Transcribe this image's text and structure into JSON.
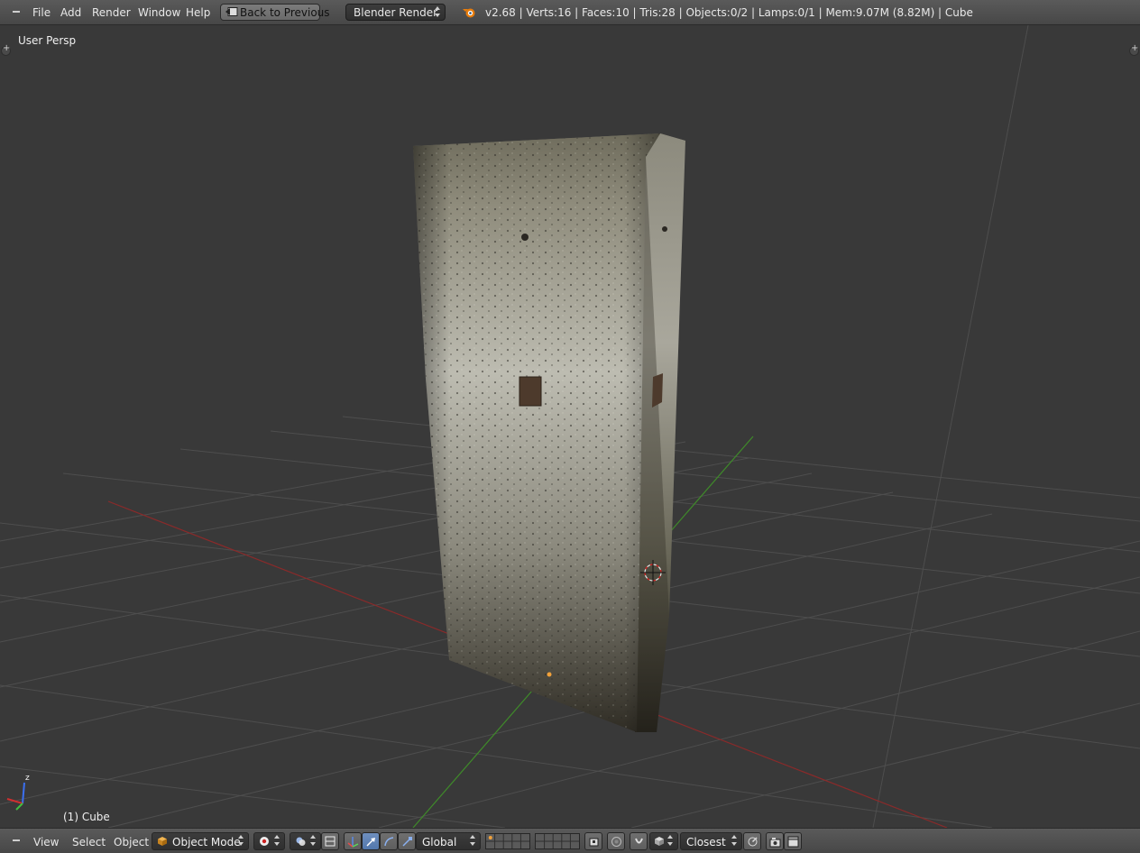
{
  "top_menu": [
    "File",
    "Add",
    "Render",
    "Window",
    "Help"
  ],
  "back_button": "Back to Previous",
  "render_engine": "Blender Render",
  "stats": "v2.68 | Verts:16 | Faces:10 | Tris:28 | Objects:0/2 | Lamps:0/1 | Mem:9.07M (8.82M) | Cube",
  "viewport": {
    "view_label": "User Persp",
    "object_label": "(1) Cube",
    "axis_z": "z"
  },
  "bottom_menu": [
    "View",
    "Select",
    "Object"
  ],
  "mode": "Object Mode",
  "transform_orientation": "Global",
  "snap_target": "Closest",
  "colors": {
    "background": "#393939",
    "header": "#4e4e4e",
    "grid": "#4c4c4c",
    "x_axis": "#8a2a2a",
    "y_axis": "#3f8a2a",
    "active_button": "#5277ad"
  },
  "icons": [
    "collapse-icon",
    "back-icon",
    "blender-logo-icon",
    "cube-icon",
    "pivot-icon",
    "shading-icon",
    "manipulator-icon",
    "translate-icon",
    "rotate-icon",
    "scale-icon",
    "layer-grid-icon",
    "lock-icon",
    "proportional-icon",
    "snap-icon",
    "snap-element-icon",
    "align-rotation-icon",
    "render-still-icon",
    "render-anim-icon",
    "3d-cursor-icon",
    "origin-icon"
  ]
}
